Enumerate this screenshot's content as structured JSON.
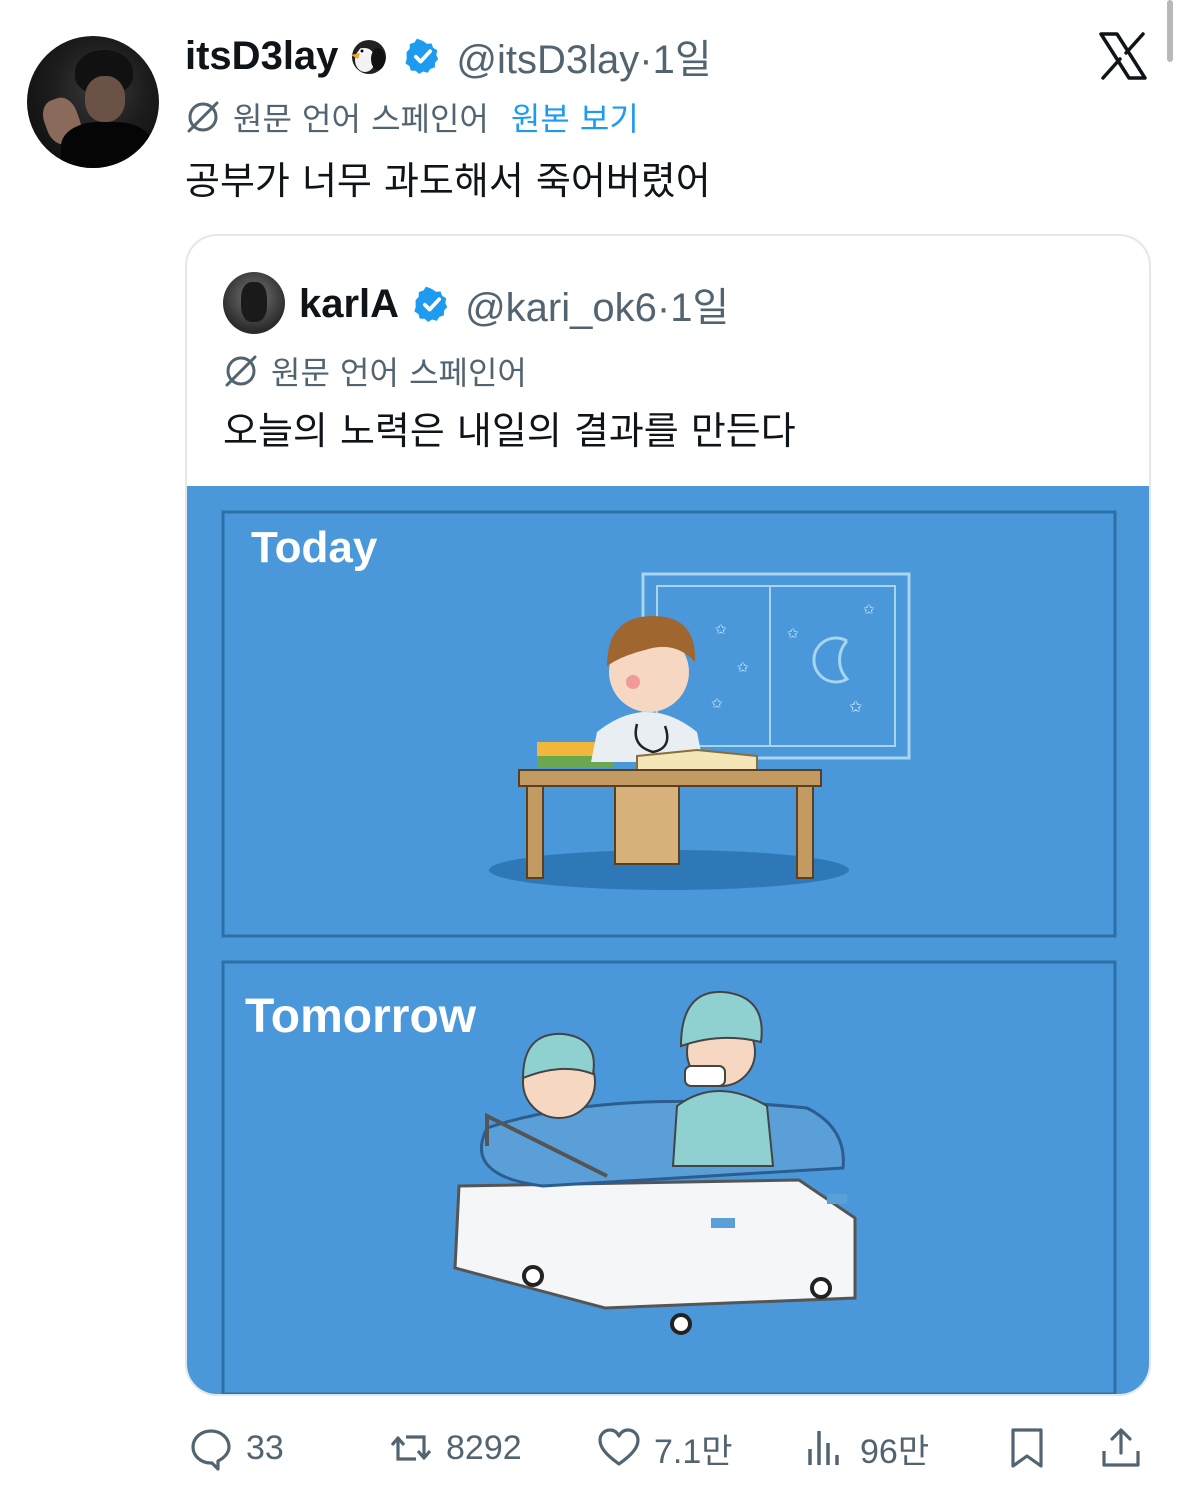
{
  "tweet": {
    "display_name": "itsD3lay",
    "handle": "@itsD3lay",
    "time": "1일",
    "translation_note": "원문 언어 스페인어",
    "show_original_label": "원본 보기",
    "text": "공부가 너무 과도해서 죽어버렸어"
  },
  "quoted_tweet": {
    "display_name": "karlA",
    "handle": "@kari_ok6",
    "time": "1일",
    "translation_note": "원문 언어 스페인어",
    "text": "오늘의 노력은 내일의 결과를 만든다",
    "image": {
      "top_panel_label": "Today",
      "bottom_panel_label": "Tomorrow"
    }
  },
  "actions": {
    "replies": "33",
    "reposts": "8292",
    "likes": "7.1만",
    "views": "96만"
  },
  "colors": {
    "accent": "#1d9bf0",
    "secondary_text": "#536471",
    "image_background": "#4a98d9"
  },
  "icons": [
    "penguin-emoji-icon",
    "verified-badge-icon",
    "x-close-icon",
    "translate-globe-icon",
    "reply-icon",
    "repost-icon",
    "like-icon",
    "views-icon",
    "bookmark-icon",
    "share-icon"
  ]
}
